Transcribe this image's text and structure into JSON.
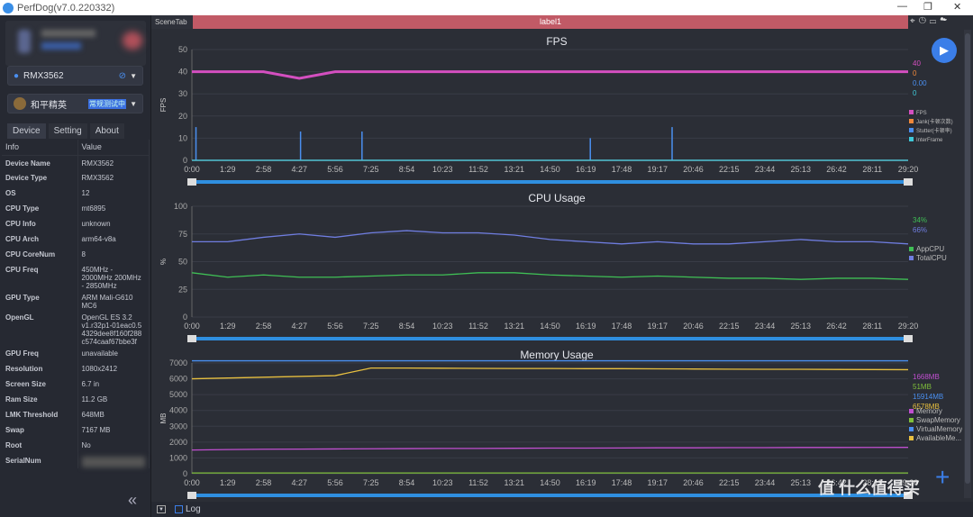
{
  "app": {
    "title": "PerfDog(v7.0.220332)"
  },
  "device_select": {
    "value": "RMX3562"
  },
  "app_select": {
    "value": "和平精英",
    "tag": "常规测试中"
  },
  "tabs": [
    "Device",
    "Setting",
    "About"
  ],
  "info_table": {
    "headers": [
      "Info",
      "Value"
    ],
    "rows": [
      [
        "Device Name",
        "RMX3562"
      ],
      [
        "Device Type",
        "RMX3562"
      ],
      [
        "OS",
        "12"
      ],
      [
        "CPU Type",
        "mt6895"
      ],
      [
        "CPU Info",
        "unknown"
      ],
      [
        "CPU Arch",
        "arm64-v8a"
      ],
      [
        "CPU CoreNum",
        "8"
      ],
      [
        "CPU Freq",
        "450MHz - 2000MHz 200MHz - 2850MHz"
      ],
      [
        "GPU Type",
        "ARM Mali-G610 MC6"
      ],
      [
        "OpenGL",
        "OpenGL ES 3.2 v1.r32p1-01eac0.5 4329dee8f160f288 c574caaf67bbe3f"
      ],
      [
        "GPU Freq",
        "unavailable"
      ],
      [
        "Resolution",
        "1080x2412"
      ],
      [
        "Screen Size",
        "6.7 in"
      ],
      [
        "Ram Size",
        "11.2 GB"
      ],
      [
        "LMK Threshold",
        "648MB"
      ],
      [
        "Swap",
        "7167 MB"
      ],
      [
        "Root",
        "No"
      ],
      [
        "SerialNum",
        ""
      ]
    ]
  },
  "scene": {
    "tab": "SceneTab",
    "label": "label1"
  },
  "bottom": {
    "log_label": "Log"
  },
  "watermark": "值 什么值得买",
  "chart_data": [
    {
      "type": "line",
      "title": "FPS",
      "ylabel": "FPS",
      "ylim": [
        0,
        50
      ],
      "yticks": [
        0,
        10,
        20,
        30,
        40,
        50
      ],
      "x": [
        "0:00",
        "1:29",
        "2:58",
        "4:27",
        "5:56",
        "7:25",
        "8:54",
        "10:23",
        "11:52",
        "13:21",
        "14:50",
        "16:19",
        "17:48",
        "19:17",
        "20:46",
        "22:15",
        "23:44",
        "25:13",
        "26:42",
        "28:11",
        "29:20"
      ],
      "series": [
        {
          "name": "FPS",
          "color": "#d44fc0",
          "current": "40",
          "values": [
            40,
            40,
            40,
            37,
            40,
            40,
            40,
            40,
            40,
            40,
            40,
            40,
            40,
            40,
            40,
            40,
            40,
            40,
            40,
            40,
            40
          ]
        },
        {
          "name": "Jank(卡顿次数)",
          "color": "#f0883a",
          "current": "0",
          "values": [
            0,
            0,
            0,
            0,
            0,
            0,
            0,
            0,
            0,
            0,
            0,
            0,
            0,
            0,
            0,
            0,
            0,
            0,
            0,
            0,
            0
          ]
        },
        {
          "name": "Stutter(卡顿率)",
          "color": "#4a8ff0",
          "current": "0.00",
          "values": [
            0,
            0,
            0,
            0,
            0,
            0,
            0,
            0,
            0,
            0,
            0,
            0,
            0,
            0,
            0,
            0,
            0,
            0,
            0,
            0,
            0
          ]
        },
        {
          "name": "InterFrame",
          "color": "#3fc8d8",
          "current": "0",
          "values": [
            0,
            0,
            0,
            0,
            0,
            0,
            0,
            0,
            0,
            0,
            0,
            0,
            0,
            0,
            0,
            0,
            0,
            0,
            0,
            0,
            0
          ]
        }
      ],
      "spikes": [
        {
          "x": "0:10",
          "value": 15
        },
        {
          "x": "4:27",
          "value": 13
        },
        {
          "x": "6:58",
          "value": 13
        },
        {
          "x": "16:19",
          "value": 10
        },
        {
          "x": "19:40",
          "value": 15
        }
      ]
    },
    {
      "type": "line",
      "title": "CPU Usage",
      "ylabel": "%",
      "ylim": [
        0,
        100
      ],
      "yticks": [
        0,
        25,
        50,
        75,
        100
      ],
      "x": [
        "0:00",
        "1:29",
        "2:58",
        "4:27",
        "5:56",
        "7:25",
        "8:54",
        "10:23",
        "11:52",
        "13:21",
        "14:50",
        "16:19",
        "17:48",
        "19:17",
        "20:46",
        "22:15",
        "23:44",
        "25:13",
        "26:42",
        "28:11",
        "29:20"
      ],
      "series": [
        {
          "name": "AppCPU",
          "color": "#3fbf55",
          "current": "34%",
          "values": [
            40,
            36,
            38,
            36,
            36,
            37,
            38,
            38,
            40,
            40,
            38,
            37,
            36,
            37,
            36,
            35,
            35,
            34,
            35,
            35,
            34
          ]
        },
        {
          "name": "TotalCPU",
          "color": "#6f7de0",
          "current": "66%",
          "values": [
            68,
            68,
            72,
            75,
            72,
            76,
            78,
            76,
            76,
            74,
            70,
            68,
            66,
            68,
            66,
            66,
            68,
            70,
            68,
            68,
            66
          ]
        }
      ]
    },
    {
      "type": "line",
      "title": "Memory Usage",
      "ylabel": "MB",
      "ylim": [
        0,
        7000
      ],
      "yticks": [
        0,
        1000,
        2000,
        3000,
        4000,
        5000,
        6000,
        7000
      ],
      "x": [
        "0:00",
        "1:29",
        "2:58",
        "4:27",
        "5:56",
        "7:25",
        "8:54",
        "10:23",
        "11:52",
        "13:21",
        "14:50",
        "16:19",
        "17:48",
        "19:17",
        "20:46",
        "22:15",
        "23:44",
        "25:13",
        "26:42",
        "28:11",
        "29:20"
      ],
      "series": [
        {
          "name": "Memory",
          "color": "#c04fd0",
          "current": "1668MB",
          "values": [
            1500,
            1530,
            1550,
            1560,
            1570,
            1580,
            1590,
            1600,
            1600,
            1610,
            1620,
            1620,
            1630,
            1640,
            1640,
            1650,
            1650,
            1660,
            1660,
            1665,
            1668
          ]
        },
        {
          "name": "SwapMemory",
          "color": "#7fbf3a",
          "current": "51MB",
          "values": [
            51,
            51,
            51,
            51,
            51,
            51,
            51,
            51,
            51,
            51,
            51,
            51,
            51,
            51,
            51,
            51,
            51,
            51,
            51,
            51,
            51
          ]
        },
        {
          "name": "VirtualMemory",
          "color": "#4a8ff0",
          "current": "15914MB",
          "values": [
            15914,
            15914,
            15914,
            15914,
            15914,
            15914,
            15914,
            15914,
            15914,
            15914,
            15914,
            15914,
            15914,
            15914,
            15914,
            15914,
            15914,
            15914,
            15914,
            15914,
            15914
          ]
        },
        {
          "name": "AvailableMe...",
          "color": "#e8c040",
          "current": "6578MB",
          "values": [
            6000,
            6050,
            6100,
            6150,
            6200,
            6680,
            6680,
            6670,
            6660,
            6650,
            6650,
            6640,
            6640,
            6630,
            6620,
            6610,
            6600,
            6600,
            6590,
            6585,
            6578
          ]
        }
      ]
    }
  ]
}
